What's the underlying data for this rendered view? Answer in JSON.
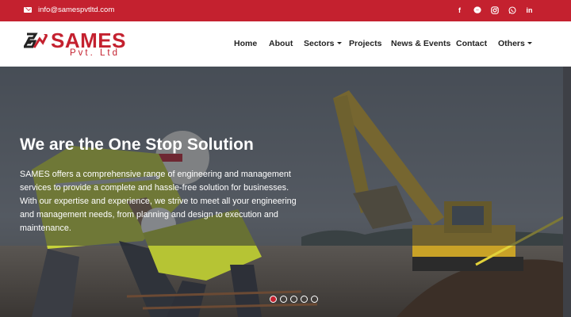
{
  "topbar": {
    "email": "info@samespvtltd.com",
    "social_icons": [
      "facebook-icon",
      "messenger-icon",
      "instagram-icon",
      "whatsapp-icon",
      "linkedin-icon"
    ]
  },
  "brand": {
    "name": "SAMES",
    "tagline": "Pvt. Ltd",
    "color": "#c4212f"
  },
  "nav": {
    "items": [
      {
        "label": "Home",
        "dropdown": false
      },
      {
        "label": "About",
        "dropdown": false
      },
      {
        "label": "Sectors",
        "dropdown": true
      },
      {
        "label": "Projects",
        "dropdown": false
      },
      {
        "label": "News & Events",
        "dropdown": false
      },
      {
        "label": "Contact",
        "dropdown": false
      },
      {
        "label": "Others",
        "dropdown": true
      }
    ]
  },
  "hero": {
    "title": "We are the One Stop Solution",
    "text": "SAMES offers a comprehensive range of engineering and management services to provide a complete and hassle-free solution for businesses. With our expertise and experience, we strive to meet all your engineering and management needs, from planning and design to execution and maintenance.",
    "slides": 5,
    "active_slide": 1
  }
}
